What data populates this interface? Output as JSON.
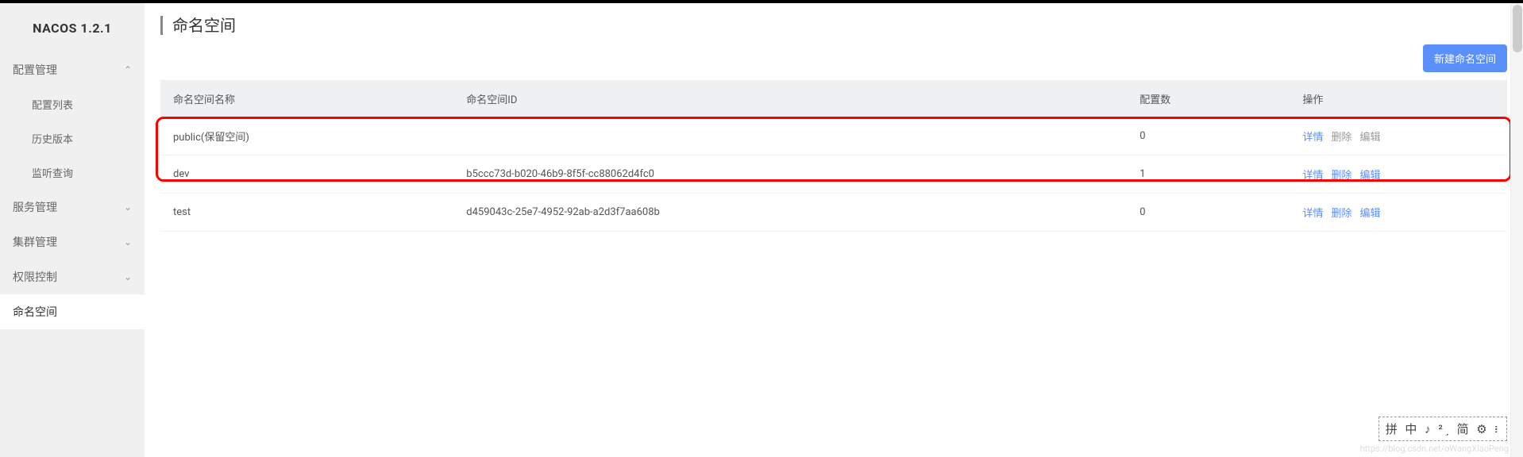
{
  "brand": "NACOS 1.2.1",
  "sidebar": {
    "items": [
      {
        "label": "配置管理",
        "expanded": true,
        "children": [
          {
            "label": "配置列表"
          },
          {
            "label": "历史版本"
          },
          {
            "label": "监听查询"
          }
        ]
      },
      {
        "label": "服务管理",
        "expanded": false
      },
      {
        "label": "集群管理",
        "expanded": false
      },
      {
        "label": "权限控制",
        "expanded": false
      },
      {
        "label": "命名空间",
        "active": true
      }
    ]
  },
  "page": {
    "title": "命名空间",
    "create_button": "新建命名空间"
  },
  "table": {
    "headers": {
      "name": "命名空间名称",
      "id": "命名空间ID",
      "count": "配置数",
      "actions": "操作"
    },
    "rows": [
      {
        "name": "public(保留空间)",
        "id": "",
        "count": "0",
        "detail": "详情",
        "delete": "删除",
        "edit": "编辑",
        "reserved": true
      },
      {
        "name": "dev",
        "id": "b5ccc73d-b020-46b9-8f5f-cc88062d4fc0",
        "count": "1",
        "detail": "详情",
        "delete": "删除",
        "edit": "编辑",
        "reserved": false
      },
      {
        "name": "test",
        "id": "d459043c-25e7-4952-92ab-a2d3f7aa608b",
        "count": "0",
        "detail": "详情",
        "delete": "删除",
        "edit": "编辑",
        "reserved": false
      }
    ]
  },
  "ime": "拼 中 ♪ ²ˏ 简 ⚙ ፧",
  "watermark": "https://blog.csdn.net/oWangXiaoPeng"
}
